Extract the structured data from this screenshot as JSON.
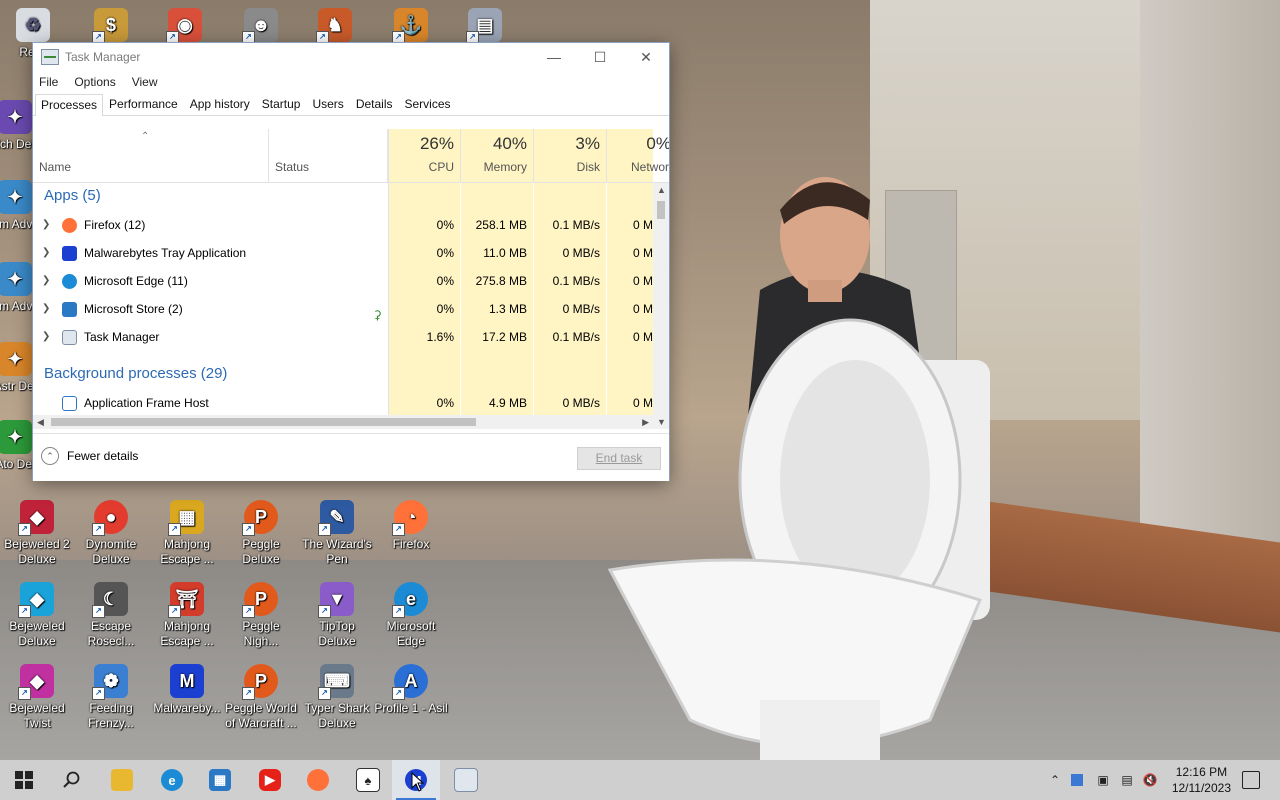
{
  "desktop": {
    "top_row_icons": [
      {
        "label": "Recy",
        "icon": "recycle-bin-icon"
      },
      {
        "label": "",
        "icon": "game-icon"
      },
      {
        "label": "",
        "icon": "game-icon"
      },
      {
        "label": "",
        "icon": "game-icon"
      },
      {
        "label": "",
        "icon": "game-icon"
      },
      {
        "label": "",
        "icon": "game-icon"
      },
      {
        "label": "",
        "icon": "task-manager-icon"
      }
    ],
    "left_column_partial": [
      "Alch Delu",
      "Am Adve",
      "Am Adve",
      "Astr Del",
      "Ato Del"
    ],
    "icons": [
      {
        "label": "Bejeweled 2 Deluxe",
        "icon": "bejeweled-icon",
        "color": "#c0223a"
      },
      {
        "label": "Dynomite Deluxe",
        "icon": "dynomite-icon",
        "color": "#e33c2f"
      },
      {
        "label": "Mahjong Escape ...",
        "icon": "mahjong-icon",
        "color": "#d9a820"
      },
      {
        "label": "Peggle Deluxe",
        "icon": "peggle-icon",
        "color": "#e25a1b"
      },
      {
        "label": "The Wizard's Pen",
        "icon": "wizard-pen-icon",
        "color": "#2d5aa0"
      },
      {
        "label": "Firefox",
        "icon": "firefox-icon",
        "color": "#ff7139"
      },
      {
        "label": "Bejeweled Deluxe",
        "icon": "bejeweled-icon",
        "color": "#1aa3d9"
      },
      {
        "label": "Escape Rosecl...",
        "icon": "escape-icon",
        "color": "#555555"
      },
      {
        "label": "Mahjong Escape ...",
        "icon": "mahjong-icon",
        "color": "#d33b2b"
      },
      {
        "label": "Peggle Nigh...",
        "icon": "peggle-icon",
        "color": "#e25a1b"
      },
      {
        "label": "TipTop Deluxe",
        "icon": "tiptop-icon",
        "color": "#8a5cc9"
      },
      {
        "label": "Microsoft Edge",
        "icon": "edge-icon",
        "color": "#1b8bd6"
      },
      {
        "label": "Bejeweled Twist",
        "icon": "bejeweled-icon",
        "color": "#c030a0"
      },
      {
        "label": "Feeding Frenzy...",
        "icon": "fish-icon",
        "color": "#3a7fd1"
      },
      {
        "label": "Malwareby...",
        "icon": "malwarebytes-icon",
        "color": "#1b3fd0"
      },
      {
        "label": "Peggle World of Warcraft ...",
        "icon": "peggle-icon",
        "color": "#e25a1b"
      },
      {
        "label": "Typer Shark Deluxe",
        "icon": "shark-icon",
        "color": "#6a7a8a"
      },
      {
        "label": "Profile 1 - Asil",
        "icon": "edge-profile-icon",
        "color": "#2a6fd6"
      }
    ]
  },
  "task_manager": {
    "title": "Task Manager",
    "menu": [
      "File",
      "Options",
      "View"
    ],
    "tabs": [
      "Processes",
      "Performance",
      "App history",
      "Startup",
      "Users",
      "Details",
      "Services"
    ],
    "active_tab": "Processes",
    "columns": {
      "name": "Name",
      "status": "Status",
      "cpu": {
        "pct": "26%",
        "label": "CPU"
      },
      "memory": {
        "pct": "40%",
        "label": "Memory"
      },
      "disk": {
        "pct": "3%",
        "label": "Disk"
      },
      "network": {
        "pct": "0%",
        "label": "Network"
      }
    },
    "groups": {
      "apps": "Apps (5)",
      "background": "Background processes (29)"
    },
    "apps": [
      {
        "name": "Firefox (12)",
        "cpu": "0%",
        "memory": "258.1 MB",
        "disk": "0.1 MB/s",
        "network": "0 M",
        "icon": "firefox-icon",
        "color": "#ff7139"
      },
      {
        "name": "Malwarebytes Tray Application",
        "cpu": "0%",
        "memory": "11.0 MB",
        "disk": "0 MB/s",
        "network": "0 M",
        "icon": "malwarebytes-icon",
        "color": "#1b3fd0"
      },
      {
        "name": "Microsoft Edge (11)",
        "cpu": "0%",
        "memory": "275.8 MB",
        "disk": "0.1 MB/s",
        "network": "0 M",
        "icon": "edge-icon",
        "color": "#1b8bd6"
      },
      {
        "name": "Microsoft Store (2)",
        "cpu": "0%",
        "memory": "1.3 MB",
        "disk": "0 MB/s",
        "network": "0 M",
        "icon": "store-icon",
        "color": "#2b78c5"
      },
      {
        "name": "Task Manager",
        "cpu": "1.6%",
        "memory": "17.2 MB",
        "disk": "0.1 MB/s",
        "network": "0 M",
        "icon": "task-manager-icon",
        "color": "#7f8fa3"
      }
    ],
    "background": [
      {
        "name": "Application Frame Host",
        "cpu": "0%",
        "memory": "4.9 MB",
        "disk": "0 MB/s",
        "network": "0 M",
        "icon": "app-frame-icon",
        "color": "#2b78c5"
      }
    ],
    "footer": {
      "fewer_details": "Fewer details",
      "end_task": "End task"
    }
  },
  "taskbar": {
    "items": [
      "start-icon",
      "search-icon",
      "file-explorer-icon",
      "edge-icon",
      "store-icon",
      "youtube-icon",
      "firefox-icon",
      "solitaire-icon",
      "malwarebytes-icon",
      "task-manager-icon"
    ],
    "active": "malwarebytes-icon",
    "time": "12:16 PM",
    "date": "12/11/2023"
  }
}
